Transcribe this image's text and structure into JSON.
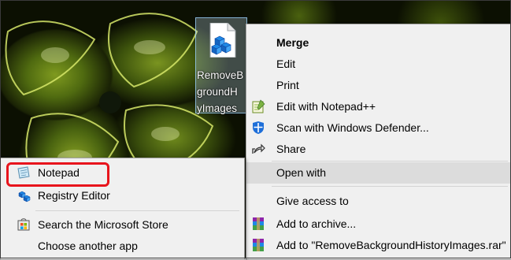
{
  "desktop": {
    "file_label": "RemoveB\ngroundH\nyImages"
  },
  "context_menu": {
    "items": [
      {
        "label": "Merge",
        "icon": ""
      },
      {
        "label": "Edit",
        "icon": ""
      },
      {
        "label": "Print",
        "icon": ""
      },
      {
        "label": "Edit with Notepad++",
        "icon": "notepad-plus-plus-icon"
      },
      {
        "label": "Scan with Windows Defender...",
        "icon": "windows-defender-icon"
      },
      {
        "label": "Share",
        "icon": "share-icon"
      },
      {
        "label": "Open with",
        "icon": ""
      },
      {
        "label": "Give access to",
        "icon": ""
      },
      {
        "label": "Add to archive...",
        "icon": "winrar-icon"
      },
      {
        "label": "Add to \"RemoveBackgroundHistoryImages.rar\"",
        "icon": "winrar-icon"
      }
    ],
    "default_item": "Merge",
    "highlighted_item": "Open with"
  },
  "open_with_menu": {
    "items": [
      {
        "label": "Notepad",
        "icon": "notepad-icon"
      },
      {
        "label": "Registry Editor",
        "icon": "registry-editor-icon"
      },
      {
        "label": "Search the Microsoft Store",
        "icon": "microsoft-store-icon"
      },
      {
        "label": "Choose another app",
        "icon": ""
      }
    ],
    "annotated_item": "Notepad"
  },
  "colors": {
    "menu_background": "#f0f0f0",
    "highlight": "#dcdcdc",
    "annotation_red": "#e8141c",
    "selection_blue": "#cce8ff"
  }
}
